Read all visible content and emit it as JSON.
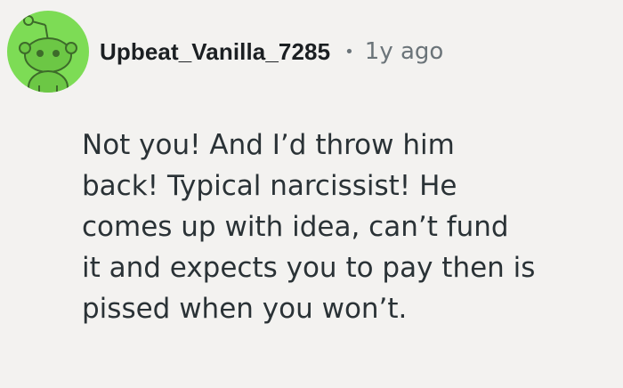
{
  "comment": {
    "author": "Upbeat_Vanilla_7285",
    "separator": "•",
    "age": "1y ago",
    "body": "Not you! And I’d throw him\nback! Typical narcissist! He\ncomes up with idea, can’t fund\nit and expects you to pay then is\npissed when you won’t."
  },
  "avatar": {
    "icon": "snoo-avatar-icon",
    "background_color": "#7ddc55"
  }
}
